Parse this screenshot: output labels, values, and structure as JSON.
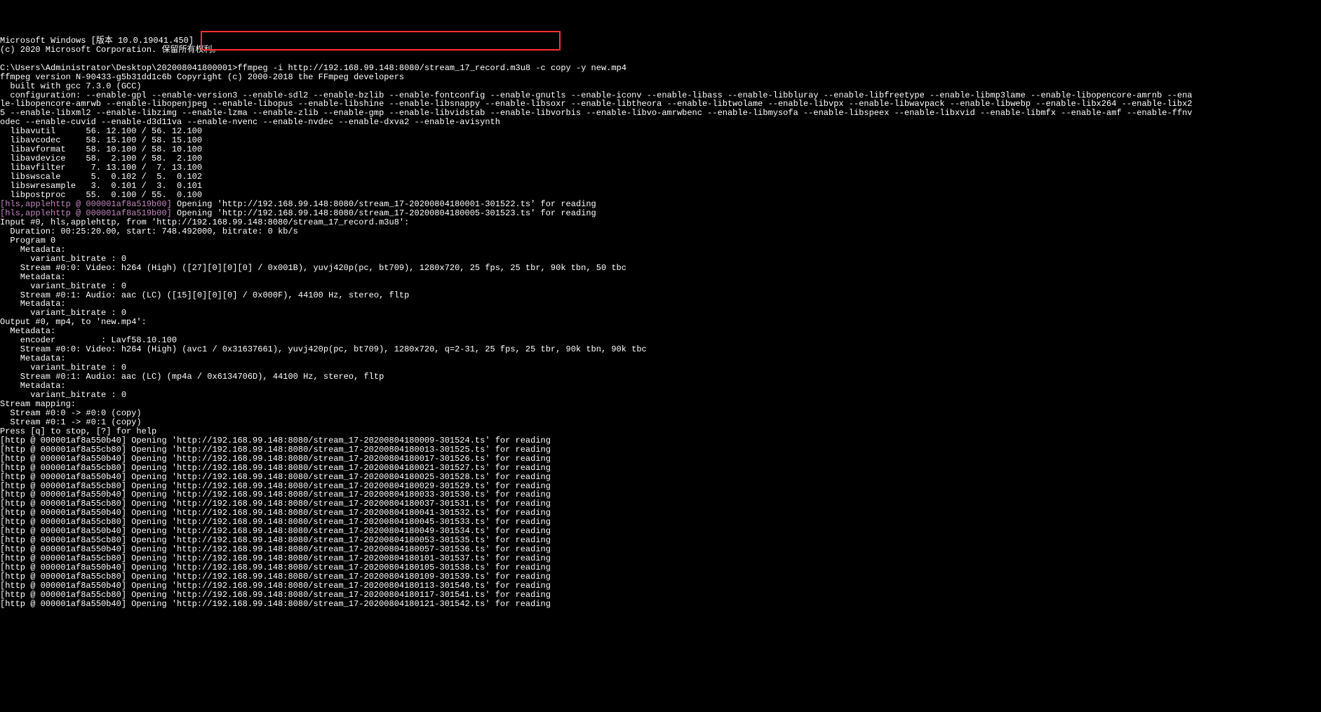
{
  "header": {
    "line1": "Microsoft Windows [版本 10.0.19041.450]",
    "line2": "(c) 2020 Microsoft Corporation. 保留所有权利。"
  },
  "prompt": {
    "path": "C:\\Users\\Administrator\\Desktop\\202008041800001>",
    "command": "ffmpeg -i http://192.168.99.148:8080/stream_17_record.m3u8 -c copy -y new.mp4"
  },
  "ffmpeg": {
    "version_line": "ffmpeg version N-90433-g5b31dd1c6b Copyright (c) 2000-2018 the FFmpeg developers",
    "built": "  built with gcc 7.3.0 (GCC)",
    "config": "  configuration: --enable-gpl --enable-version3 --enable-sdl2 --enable-bzlib --enable-fontconfig --enable-gnutls --enable-iconv --enable-libass --enable-libbluray --enable-libfreetype --enable-libmp3lame --enable-libopencore-amrnb --ena\nle-libopencore-amrwb --enable-libopenjpeg --enable-libopus --enable-libshine --enable-libsnappy --enable-libsoxr --enable-libtheora --enable-libtwolame --enable-libvpx --enable-libwavpack --enable-libwebp --enable-libx264 --enable-libx2\n5 --enable-libxml2 --enable-libzimg --enable-lzma --enable-zlib --enable-gmp --enable-libvidstab --enable-libvorbis --enable-libvo-amrwbenc --enable-libmysofa --enable-libspeex --enable-libxvid --enable-libmfx --enable-amf --enable-ffnv\nodec --enable-cuvid --enable-d3d11va --enable-nvenc --enable-nvdec --enable-dxva2 --enable-avisynth"
  },
  "libs": [
    "  libavutil      56. 12.100 / 56. 12.100",
    "  libavcodec     58. 15.100 / 58. 15.100",
    "  libavformat    58. 10.100 / 58. 10.100",
    "  libavdevice    58.  2.100 / 58.  2.100",
    "  libavfilter     7. 13.100 /  7. 13.100",
    "  libswscale      5.  0.102 /  5.  0.102",
    "  libswresample   3.  0.101 /  3.  0.101",
    "  libpostproc    55.  0.100 / 55.  0.100"
  ],
  "hls_opens": [
    {
      "tag": "[hls,applehttp @ 000001af8a519b00]",
      "msg": " Opening 'http://192.168.99.148:8080/stream_17-20200804180001-301522.ts' for reading"
    },
    {
      "tag": "[hls,applehttp @ 000001af8a519b00]",
      "msg": " Opening 'http://192.168.99.148:8080/stream_17-20200804180005-301523.ts' for reading"
    }
  ],
  "input_block": [
    "Input #0, hls,applehttp, from 'http://192.168.99.148:8080/stream_17_record.m3u8':",
    "  Duration: 00:25:20.00, start: 748.492000, bitrate: 0 kb/s",
    "  Program 0",
    "    Metadata:",
    "      variant_bitrate : 0",
    "    Stream #0:0: Video: h264 (High) ([27][0][0][0] / 0x001B), yuvj420p(pc, bt709), 1280x720, 25 fps, 25 tbr, 90k tbn, 50 tbc",
    "    Metadata:",
    "      variant_bitrate : 0",
    "    Stream #0:1: Audio: aac (LC) ([15][0][0][0] / 0x000F), 44100 Hz, stereo, fltp",
    "    Metadata:",
    "      variant_bitrate : 0",
    "Output #0, mp4, to 'new.mp4':",
    "  Metadata:",
    "    encoder         : Lavf58.10.100",
    "    Stream #0:0: Video: h264 (High) (avc1 / 0x31637661), yuvj420p(pc, bt709), 1280x720, q=2-31, 25 fps, 25 tbr, 90k tbn, 90k tbc",
    "    Metadata:",
    "      variant_bitrate : 0",
    "    Stream #0:1: Audio: aac (LC) (mp4a / 0x6134706D), 44100 Hz, stereo, fltp",
    "    Metadata:",
    "      variant_bitrate : 0",
    "Stream mapping:",
    "  Stream #0:0 -> #0:0 (copy)",
    "  Stream #0:1 -> #0:1 (copy)",
    "Press [q] to stop, [?] for help"
  ],
  "http_opens": [
    "[http @ 000001af8a550b40] Opening 'http://192.168.99.148:8080/stream_17-20200804180009-301524.ts' for reading",
    "[http @ 000001af8a55cb80] Opening 'http://192.168.99.148:8080/stream_17-20200804180013-301525.ts' for reading",
    "[http @ 000001af8a550b40] Opening 'http://192.168.99.148:8080/stream_17-20200804180017-301526.ts' for reading",
    "[http @ 000001af8a55cb80] Opening 'http://192.168.99.148:8080/stream_17-20200804180021-301527.ts' for reading",
    "[http @ 000001af8a550b40] Opening 'http://192.168.99.148:8080/stream_17-20200804180025-301528.ts' for reading",
    "[http @ 000001af8a55cb80] Opening 'http://192.168.99.148:8080/stream_17-20200804180029-301529.ts' for reading",
    "[http @ 000001af8a550b40] Opening 'http://192.168.99.148:8080/stream_17-20200804180033-301530.ts' for reading",
    "[http @ 000001af8a55cb80] Opening 'http://192.168.99.148:8080/stream_17-20200804180037-301531.ts' for reading",
    "[http @ 000001af8a550b40] Opening 'http://192.168.99.148:8080/stream_17-20200804180041-301532.ts' for reading",
    "[http @ 000001af8a55cb80] Opening 'http://192.168.99.148:8080/stream_17-20200804180045-301533.ts' for reading",
    "[http @ 000001af8a550b40] Opening 'http://192.168.99.148:8080/stream_17-20200804180049-301534.ts' for reading",
    "[http @ 000001af8a55cb80] Opening 'http://192.168.99.148:8080/stream_17-20200804180053-301535.ts' for reading",
    "[http @ 000001af8a550b40] Opening 'http://192.168.99.148:8080/stream_17-20200804180057-301536.ts' for reading",
    "[http @ 000001af8a55cb80] Opening 'http://192.168.99.148:8080/stream_17-20200804180101-301537.ts' for reading",
    "[http @ 000001af8a550b40] Opening 'http://192.168.99.148:8080/stream_17-20200804180105-301538.ts' for reading",
    "[http @ 000001af8a55cb80] Opening 'http://192.168.99.148:8080/stream_17-20200804180109-301539.ts' for reading",
    "[http @ 000001af8a550b40] Opening 'http://192.168.99.148:8080/stream_17-20200804180113-301540.ts' for reading",
    "[http @ 000001af8a55cb80] Opening 'http://192.168.99.148:8080/stream_17-20200804180117-301541.ts' for reading",
    "[http @ 000001af8a550b40] Opening 'http://192.168.99.148:8080/stream_17-20200804180121-301542.ts' for reading"
  ]
}
